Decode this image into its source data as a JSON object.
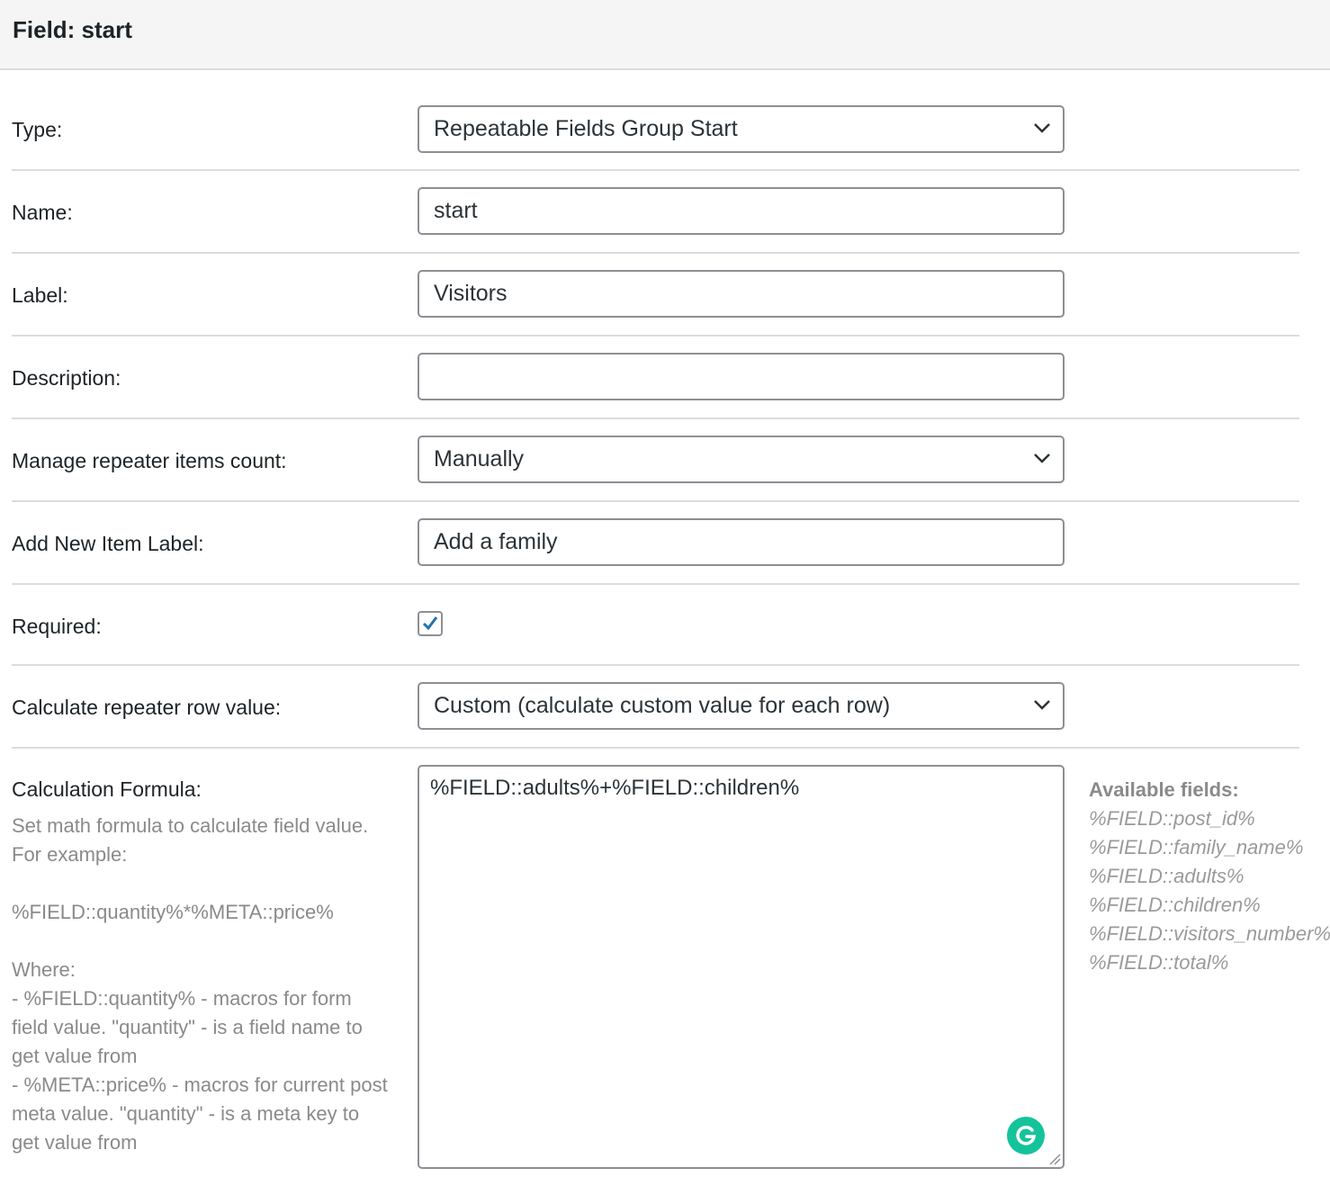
{
  "header": {
    "title": "Field: start"
  },
  "rows": {
    "type": {
      "label": "Type:",
      "value": "Repeatable Fields Group Start"
    },
    "name": {
      "label": "Name:",
      "value": "start"
    },
    "label": {
      "label": "Label:",
      "value": "Visitors"
    },
    "description": {
      "label": "Description:",
      "value": ""
    },
    "manage_count": {
      "label": "Manage repeater items count:",
      "value": "Manually"
    },
    "new_item_label": {
      "label": "Add New Item Label:",
      "value": "Add a family"
    },
    "required": {
      "label": "Required:",
      "checked": true
    },
    "calc_row": {
      "label": "Calculate repeater row value:",
      "value": "Custom (calculate custom value for each row)"
    }
  },
  "formula": {
    "label": "Calculation Formula:",
    "value": "%FIELD::adults%+%FIELD::children%",
    "description_lines": [
      "Set math formula to calculate field value.",
      "For example:",
      "",
      "%FIELD::quantity%*%META::price%",
      "",
      "Where:",
      "- %FIELD::quantity% - macros for form",
      "field value. \"quantity\" - is a field name to",
      "get value from",
      "- %META::price% - macros for current post",
      "meta value. \"quantity\" - is a meta key to",
      "get value from"
    ]
  },
  "available_fields": {
    "title": "Available fields:",
    "items": [
      "%FIELD::post_id%",
      "%FIELD::family_name%",
      "%FIELD::adults%",
      "%FIELD::children%",
      "%FIELD::visitors_number%",
      "%FIELD::total%"
    ]
  },
  "colors": {
    "checkbox_check": "#2271b1",
    "grammarly": "#15c39a",
    "border": "#8c8f94"
  },
  "icons": {
    "select_arrow": "chevron-down-icon",
    "checkbox_mark": "checkmark-icon",
    "grammarly": "grammarly-icon",
    "resize": "resize-handle-icon"
  }
}
